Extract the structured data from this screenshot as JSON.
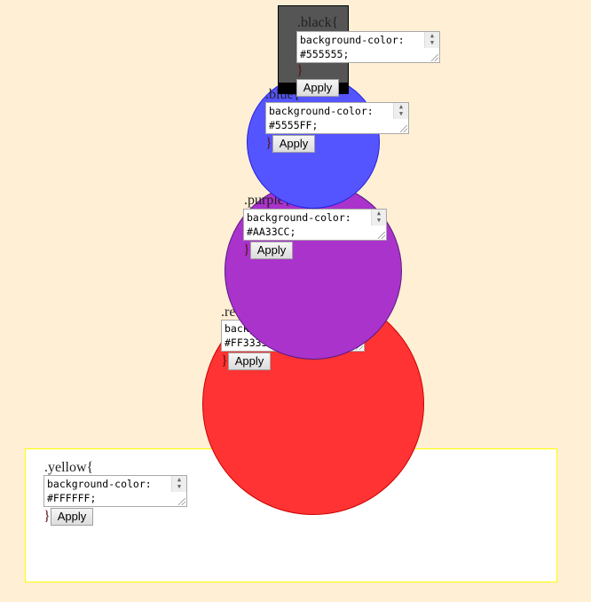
{
  "apply_label": "Apply",
  "close_brace": "}",
  "rules": {
    "yellow": {
      "selector": ".yellow{",
      "css": "background-color:\n#FFFFFF;",
      "color": "#FFFFFF",
      "border": "#FFFF00"
    },
    "red": {
      "selector": ".red{",
      "css": "background-color:\n#FF3333;",
      "color": "#FF3333"
    },
    "purple": {
      "selector": ".purple{",
      "css": "background-color:\n#AA33CC;",
      "color": "#AA33CC"
    },
    "blue": {
      "selector": ".blue{",
      "css": "background-color:\n#5555FF;",
      "color": "#5555FF"
    },
    "black": {
      "selector": ".black{",
      "css": "background-color:\n#555555;",
      "color": "#555555"
    }
  }
}
